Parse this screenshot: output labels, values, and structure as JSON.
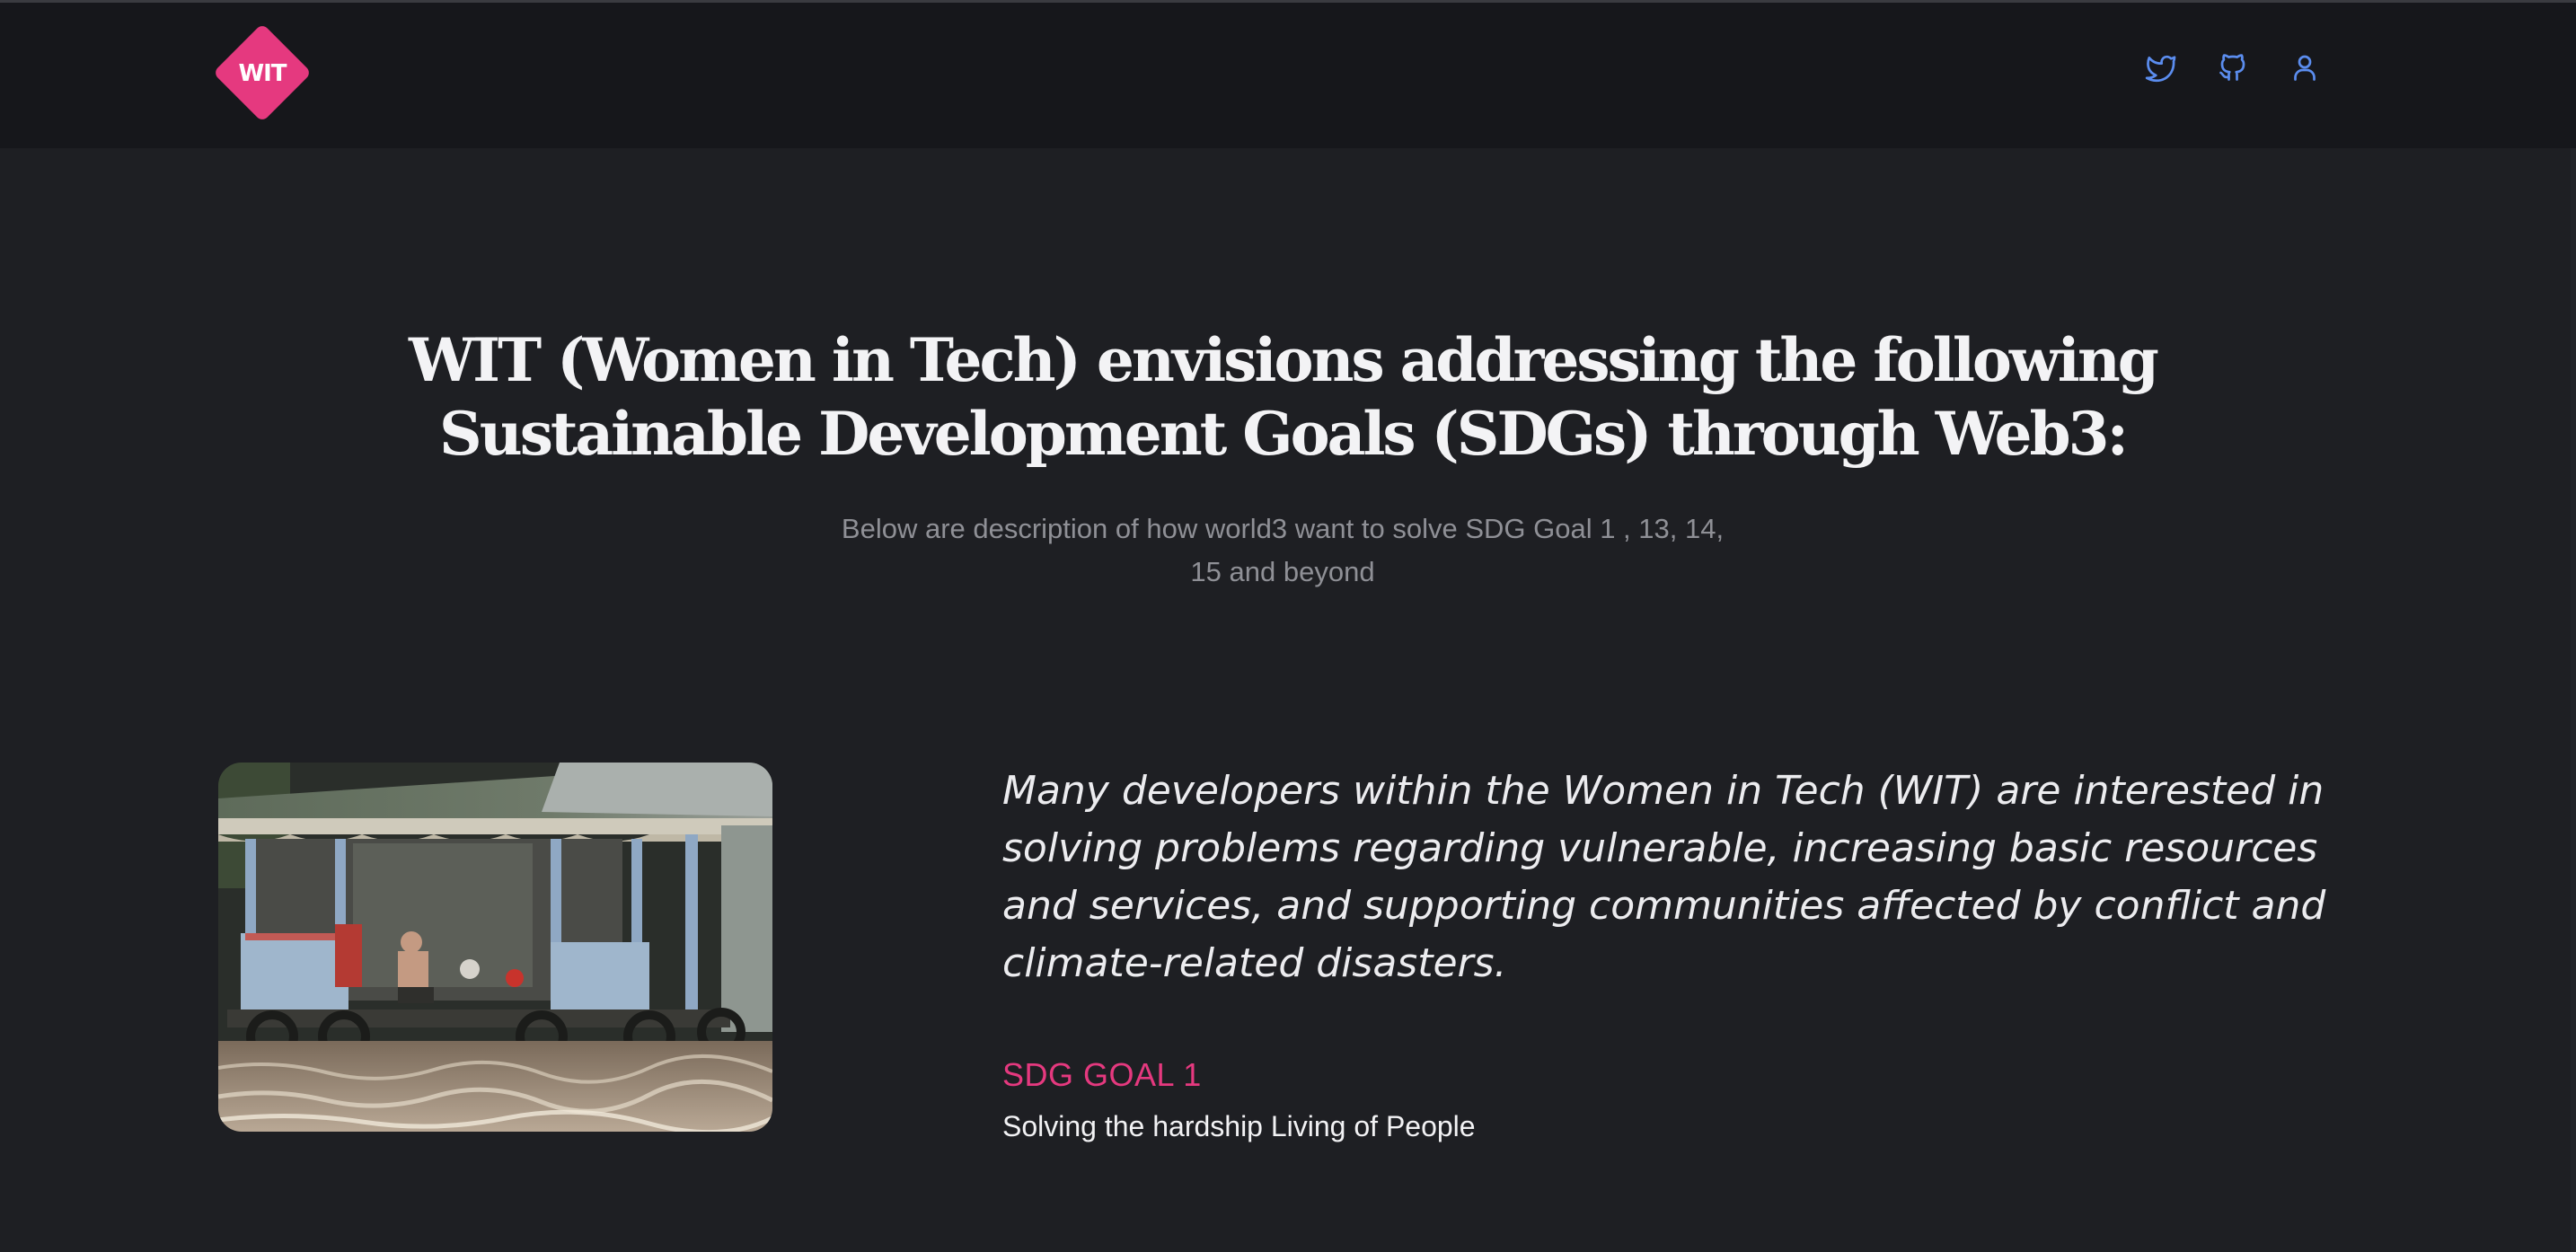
{
  "header": {
    "logo_text": "WIT",
    "icons": [
      "twitter-icon",
      "github-icon",
      "user-icon"
    ],
    "icon_color": "#5b8def",
    "brand_color": "#e5397f"
  },
  "hero": {
    "title": "WIT (Women in Tech) envisions addressing the following Sustainable Development Goals (SDGs) through Web3:",
    "subtitle": "Below are description of how world3 want to solve SDG Goal 1 , 13, 14, 15 and beyond"
  },
  "section": {
    "image_description": "photo-floating-house-flood",
    "quote": "Many developers within the Women in Tech (WIT) are interested in solving problems regarding vulnerable, increasing basic resources and services, and supporting communities affected by conflict and climate-related disasters.",
    "goal_label": "SDG GOAL 1",
    "goal_description": "Solving the hardship Living of People"
  }
}
